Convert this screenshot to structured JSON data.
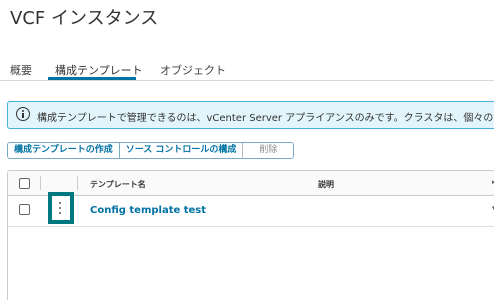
{
  "page": {
    "title": "VCF インスタンス"
  },
  "tabs": [
    {
      "label": "概要",
      "active": false
    },
    {
      "label": "構成テンプレート",
      "active": true
    },
    {
      "label": "オブジェクト",
      "active": false
    }
  ],
  "alert": {
    "icon": "info-icon",
    "text": "構成テンプレートで管理できるのは、vCenter Server アプライアンスのみです。クラスタは、個々の vCenter"
  },
  "toolbar": {
    "create_label": "構成テンプレートの作成",
    "source_label": "ソース コントロールの構成",
    "delete_label": "削除"
  },
  "grid": {
    "columns": {
      "name": "テンプレート名",
      "description": "説明"
    },
    "rows": [
      {
        "name": "Config template test",
        "description": ""
      }
    ]
  },
  "colors": {
    "accent": "#0072a3",
    "highlight": "#007880",
    "info_bg": "#e3f5fc",
    "info_border": "#49afd9"
  }
}
